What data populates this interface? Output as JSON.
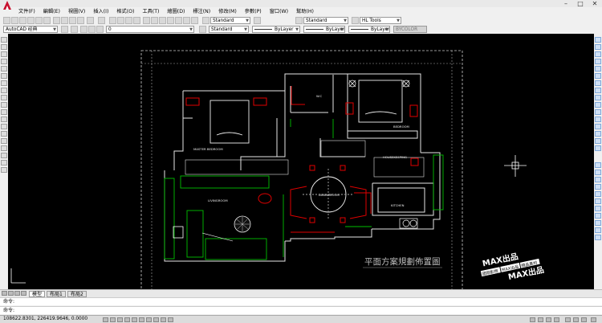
{
  "menu": {
    "items": [
      "文件(F)",
      "編輯(E)",
      "視圖(V)",
      "插入(I)",
      "格式(O)",
      "工具(T)",
      "繪圖(D)",
      "標注(N)",
      "修改(M)",
      "參數(P)",
      "窗口(W)",
      "幫助(H)"
    ]
  },
  "toolbar": {
    "text_style": "Standard",
    "dim_style": "Standard",
    "tools_menu": "HL Tools"
  },
  "props": {
    "workspace": "AutoCAD 经典",
    "layer": "0",
    "text_style2": "Standard",
    "color": "ByLayer",
    "linetype": "ByLayer",
    "lineweight": "ByLayer",
    "plot_style": "BYCOLOR"
  },
  "drawing": {
    "labels": {
      "master_bedroom": "MASTER BEDROOM",
      "bedroom": "BEDROOM",
      "living_room": "LIVINGROOM",
      "dining_room": "DININGROOM",
      "kitchen": "KITCHEN",
      "housekeeping": "HOUSEKEEPING",
      "bath": "W.C"
    },
    "plan_title": "平面方案規劃佈置圖"
  },
  "watermark": {
    "brand": "MAX出品",
    "tag1": "國際影視",
    "tag2": "MAX出品",
    "tag3": "精品素材"
  },
  "tabs": [
    "模型",
    "布局1",
    "布局2"
  ],
  "command": {
    "line1": "命令:",
    "line2": "命令:"
  },
  "status": {
    "coords": "108622.8301, 226419.9646, 0.0000"
  }
}
